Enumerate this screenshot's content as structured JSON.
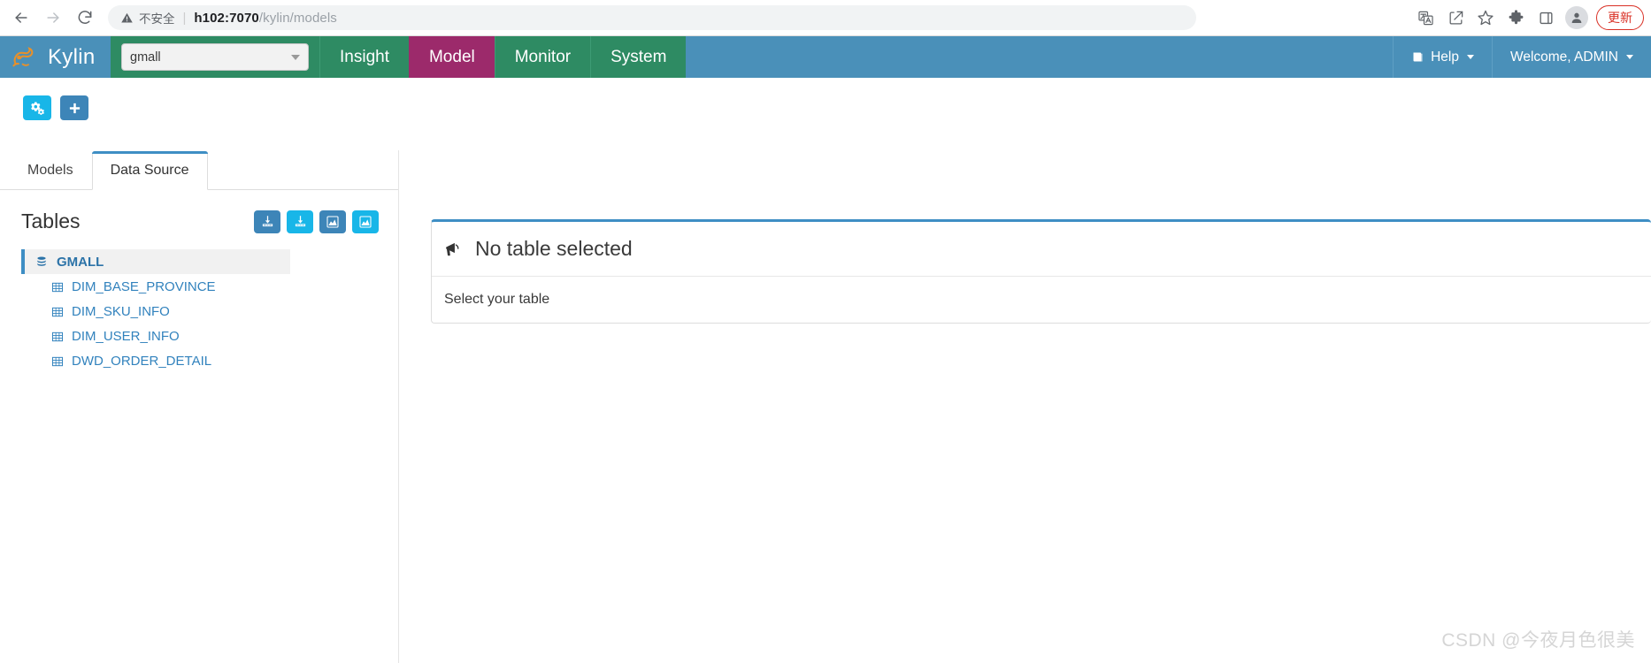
{
  "browser": {
    "back_icon": "arrow-left-icon",
    "forward_icon": "arrow-right-icon",
    "reload_icon": "reload-icon",
    "security_label": "不安全",
    "url_host": "h102:7070",
    "url_path": "/kylin/models",
    "actions": [
      {
        "name": "translate-icon",
        "label": "Translate"
      },
      {
        "name": "share-icon",
        "label": "Share"
      },
      {
        "name": "bookmark-star-icon",
        "label": "Bookmark"
      },
      {
        "name": "extensions-puzzle-icon",
        "label": "Extensions"
      },
      {
        "name": "side-panel-icon",
        "label": "Side panel"
      },
      {
        "name": "profile-avatar-icon",
        "label": "Profile"
      }
    ],
    "update_label": "更新"
  },
  "kylin": {
    "brand": "Kylin",
    "brand_logo_icon": "kylin-logo-icon",
    "project_select": {
      "value": "gmall",
      "caret_icon": "chevron-down-icon"
    },
    "nav_items": [
      {
        "label": "Insight",
        "active": false
      },
      {
        "label": "Model",
        "active": true
      },
      {
        "label": "Monitor",
        "active": false
      },
      {
        "label": "System",
        "active": false
      }
    ],
    "help": {
      "label": "Help",
      "icon": "book-icon",
      "caret_icon": "chevron-down-icon"
    },
    "user": {
      "label": "Welcome, ADMIN",
      "caret_icon": "chevron-down-icon"
    },
    "colors": {
      "brand_blue": "#4a90b9",
      "nav_green": "#2e8b63",
      "nav_active_purple": "#9c2a6b",
      "accent_blue": "#3e8ec4",
      "cyan": "#18b6e8",
      "steel": "#3d85b8"
    }
  },
  "toolbar": {
    "buttons": [
      {
        "name": "manage-cubes-button",
        "icon": "gears-icon",
        "style": "cyan"
      },
      {
        "name": "add-button",
        "icon": "plus-icon",
        "style": "steel"
      }
    ]
  },
  "sidebar": {
    "tabs": [
      {
        "label": "Models",
        "active": false
      },
      {
        "label": "Data Source",
        "active": true
      }
    ],
    "tables_title": "Tables",
    "tables_actions": [
      {
        "name": "load-table-button",
        "icon": "download-table-icon",
        "style": "steel"
      },
      {
        "name": "load-table-from-tree-button",
        "icon": "download-table-icon",
        "style": "cyan"
      },
      {
        "name": "calculate-cardinality-button",
        "icon": "chart-icon",
        "style": "steel"
      },
      {
        "name": "show-statistics-button",
        "icon": "chart-icon",
        "style": "cyan"
      }
    ],
    "tree": {
      "database": {
        "label": "GMALL",
        "icon": "database-icon"
      },
      "tables": [
        {
          "label": "DIM_BASE_PROVINCE",
          "icon": "table-icon"
        },
        {
          "label": "DIM_SKU_INFO",
          "icon": "table-icon"
        },
        {
          "label": "DIM_USER_INFO",
          "icon": "table-icon"
        },
        {
          "label": "DWD_ORDER_DETAIL",
          "icon": "table-icon"
        }
      ]
    }
  },
  "main": {
    "panel_icon": "bullhorn-icon",
    "panel_title": "No table selected",
    "panel_body": "Select your table"
  },
  "watermark": "CSDN @今夜月色很美"
}
